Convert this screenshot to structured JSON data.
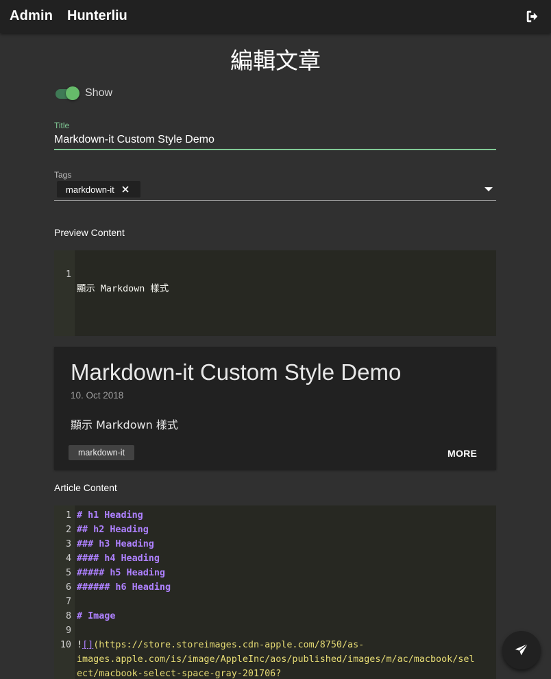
{
  "app": {
    "brand": "Admin",
    "user": "Hunterliu",
    "logout_icon": "logout-icon"
  },
  "page": {
    "title": "編輯文章"
  },
  "show_toggle": {
    "label": "Show",
    "on": true
  },
  "title_field": {
    "label": "Title",
    "value": "Markdown-it Custom Style Demo"
  },
  "tags_field": {
    "label": "Tags",
    "tags": [
      "markdown-it"
    ]
  },
  "preview_content": {
    "label": "Preview Content",
    "lines": [
      {
        "n": "1",
        "text": "顯示 Markdown 樣式"
      }
    ]
  },
  "preview_card": {
    "title": "Markdown-it Custom Style Demo",
    "date": "10. Oct 2018",
    "body": "顯示 Markdown 樣式",
    "tag": "markdown-it",
    "more": "MORE"
  },
  "article_content": {
    "label": "Article Content",
    "lines": [
      {
        "n": "1",
        "text": "# h1 Heading"
      },
      {
        "n": "2",
        "text": "## h2 Heading"
      },
      {
        "n": "3",
        "text": "### h3 Heading"
      },
      {
        "n": "4",
        "text": "#### h4 Heading"
      },
      {
        "n": "5",
        "text": "##### h5 Heading"
      },
      {
        "n": "6",
        "text": "###### h6 Heading"
      },
      {
        "n": "7",
        "text": ""
      },
      {
        "n": "8",
        "text": "# Image"
      },
      {
        "n": "9",
        "text": ""
      },
      {
        "n": "10",
        "text": "![](https://store.storeimages.cdn-apple.com/8750/as-",
        "cont": [
          "images.apple.com/is/image/AppleInc/aos/published/images/m/ac/macbook/sel",
          "ect/macbook-select-space-gray-201706?"
        ]
      }
    ]
  },
  "colors": {
    "accent": "#81c995",
    "background": "#303030",
    "appbar": "#212121",
    "editor_bg": "#272822",
    "heading_syntax": "#ae81ff",
    "string_syntax": "#e6db74"
  },
  "fab": {
    "icon": "send-icon"
  }
}
